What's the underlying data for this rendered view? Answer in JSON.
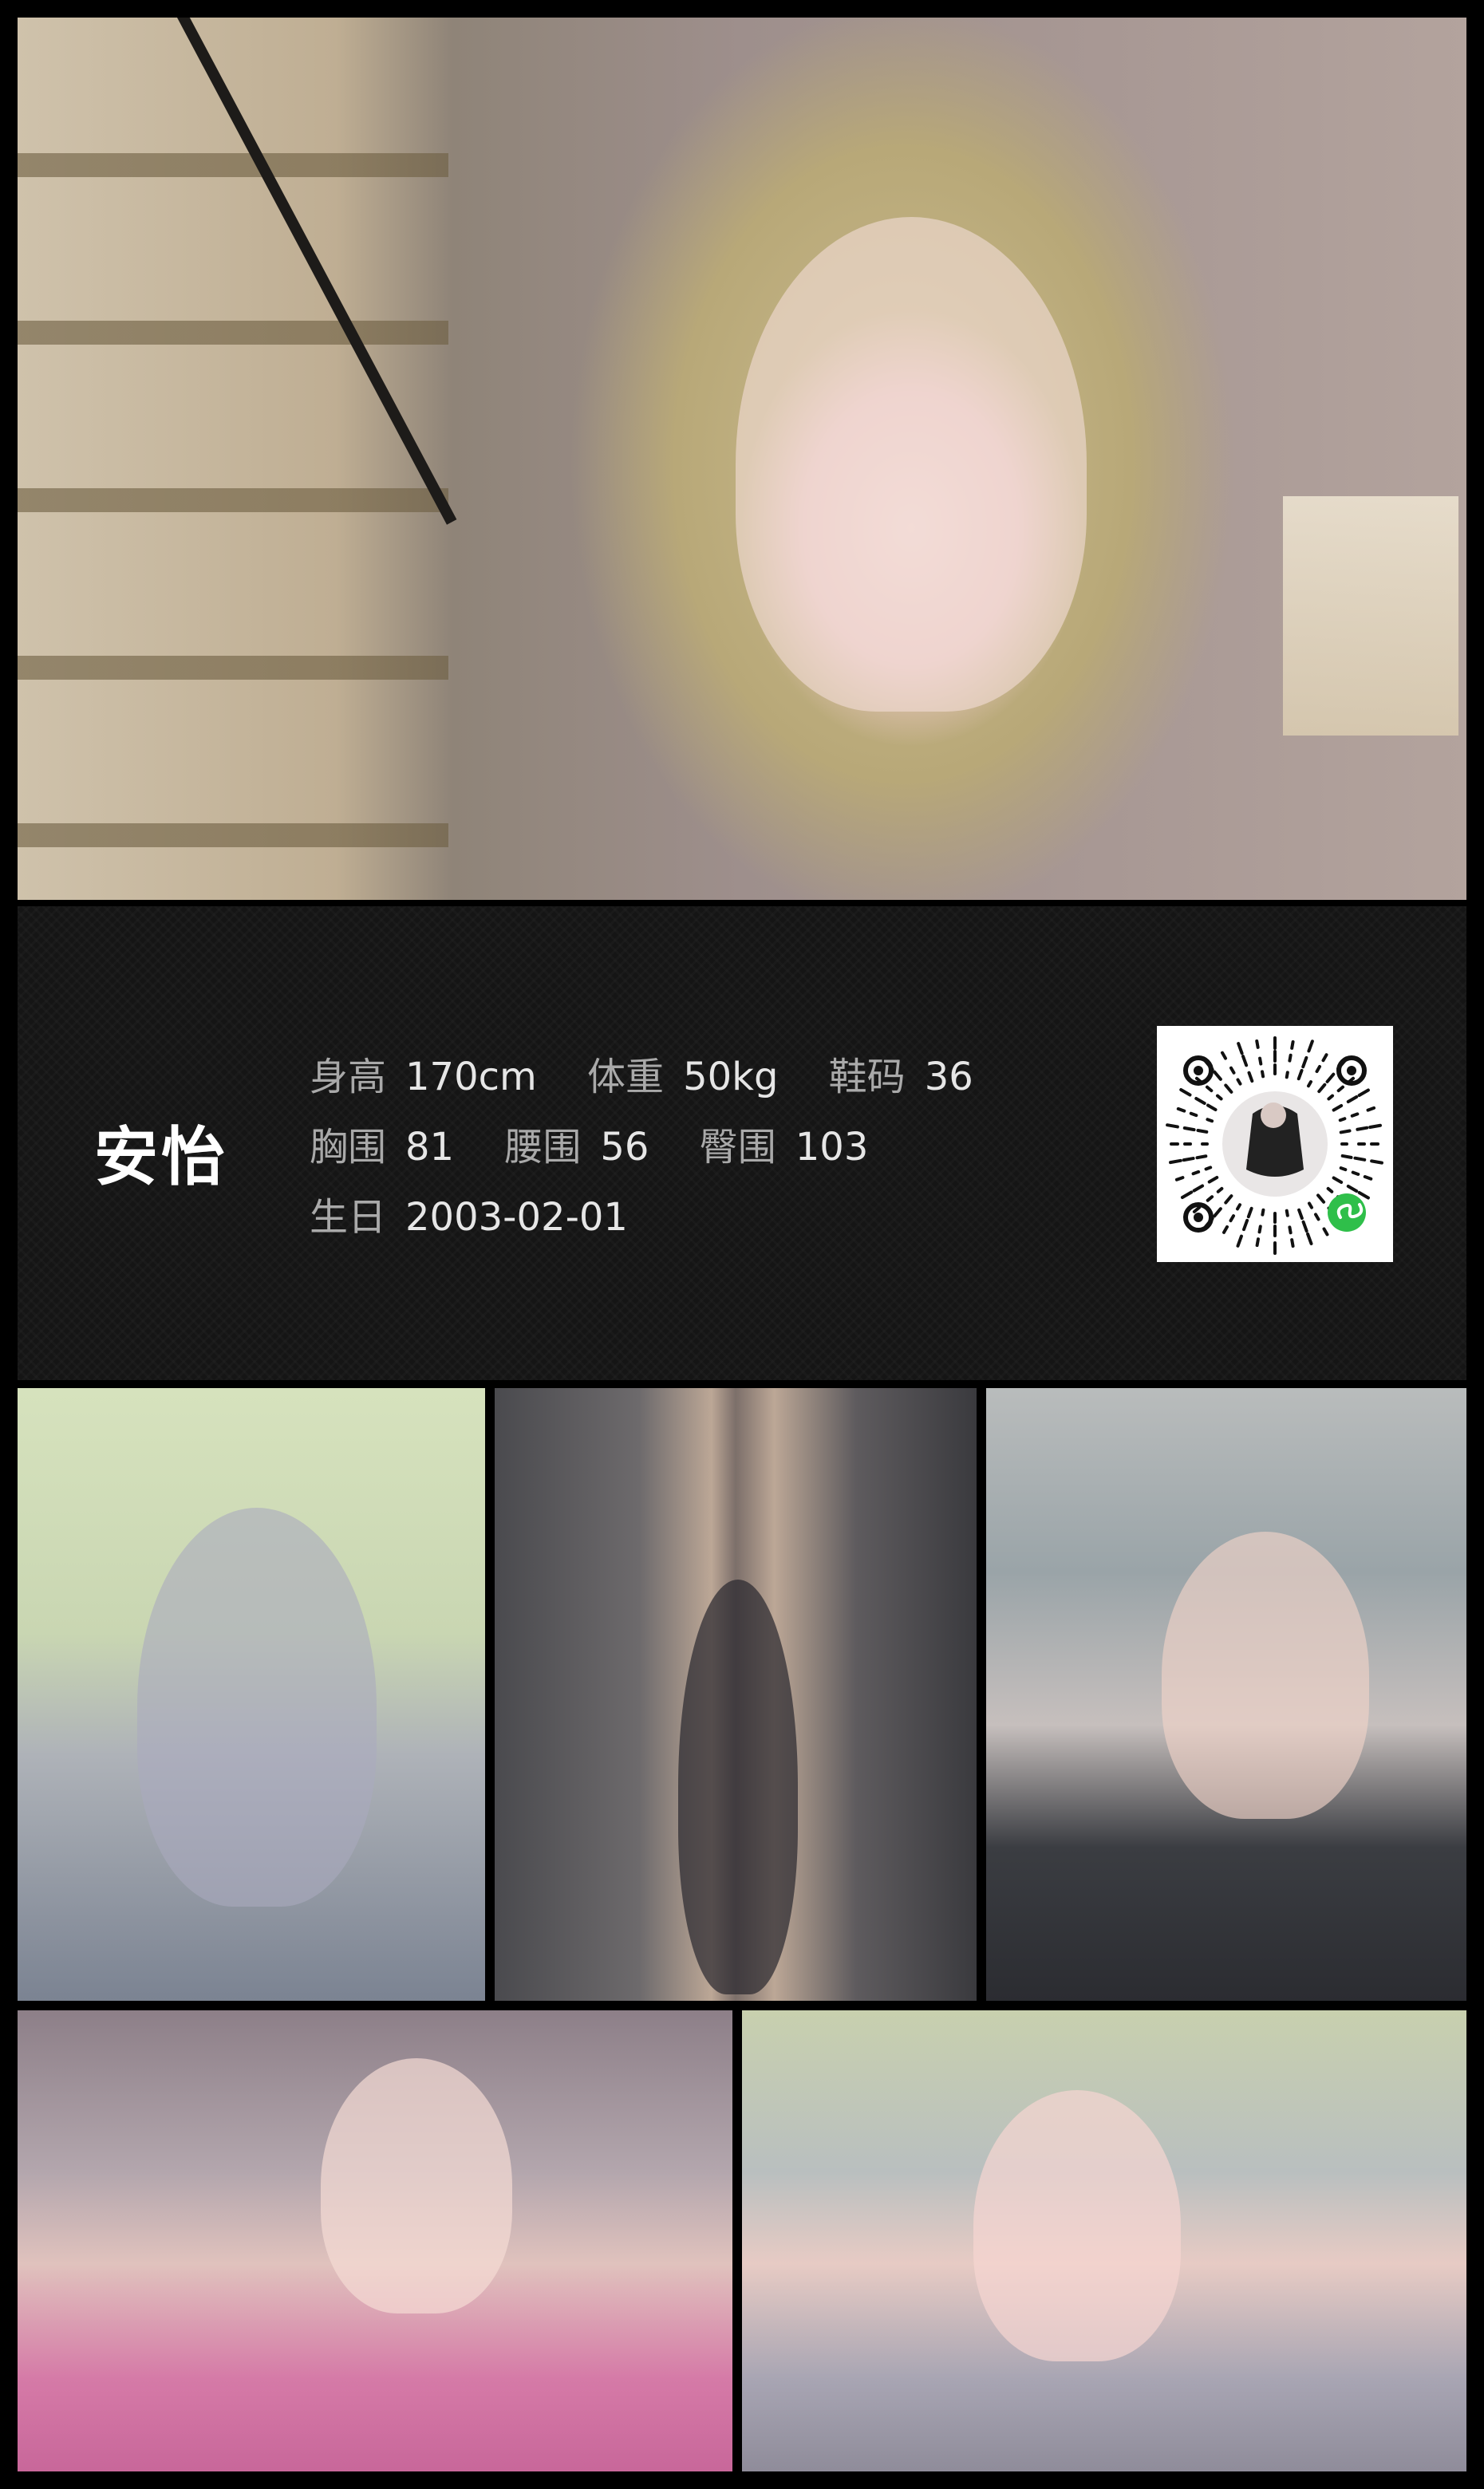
{
  "hero_photo": {
    "alt": "portrait-photo"
  },
  "profile": {
    "name": "安怡",
    "stats": [
      [
        {
          "label": "身高",
          "value": "170cm"
        },
        {
          "label": "体重",
          "value": "50kg"
        },
        {
          "label": "鞋码",
          "value": "36"
        }
      ],
      [
        {
          "label": "胸围",
          "value": "81"
        },
        {
          "label": "腰围",
          "value": "56"
        },
        {
          "label": "臀围",
          "value": "103"
        }
      ],
      [
        {
          "label": "生日",
          "value": "2003-02-01"
        }
      ]
    ]
  },
  "qr_code": {
    "icon": "wechat-mini-program-code",
    "badge_color": "#2fbf4a"
  },
  "gallery": {
    "photos": [
      "photo-1",
      "photo-2",
      "photo-3",
      "photo-4",
      "photo-5"
    ]
  },
  "colors": {
    "background": "#000000",
    "panel": "#151515",
    "label": "#a9a9a9",
    "value": "#e6e6e6",
    "name": "#ffffff"
  }
}
